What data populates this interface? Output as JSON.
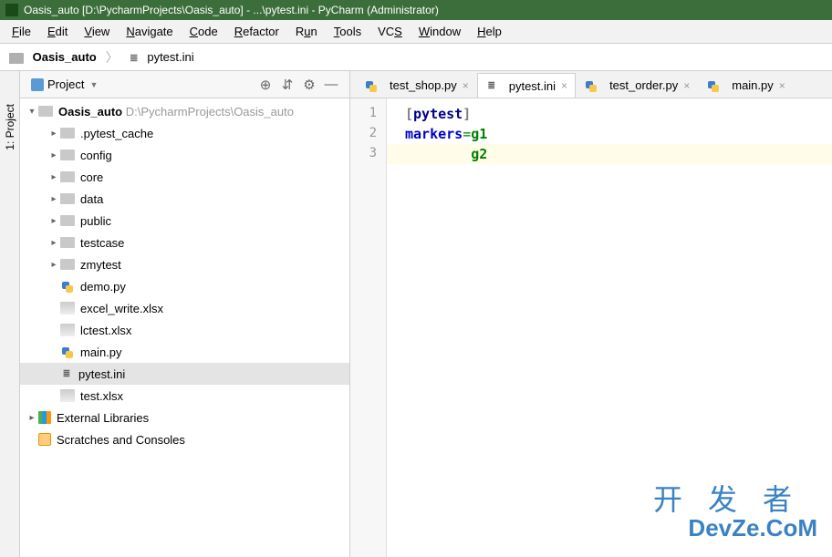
{
  "titlebar": {
    "text": "Oasis_auto [D:\\PycharmProjects\\Oasis_auto] - ...\\pytest.ini - PyCharm (Administrator)"
  },
  "menu": {
    "file": "File",
    "edit": "Edit",
    "view": "View",
    "navigate": "Navigate",
    "code": "Code",
    "refactor": "Refactor",
    "run": "Run",
    "tools": "Tools",
    "vcs": "VCS",
    "window": "Window",
    "help": "Help"
  },
  "breadcrumb": {
    "root": "Oasis_auto",
    "file": "pytest.ini"
  },
  "sidebar": {
    "project_tab": "1: Project"
  },
  "tree_header": {
    "label": "Project"
  },
  "tree": {
    "root": "Oasis_auto",
    "root_path": "D:\\PycharmProjects\\Oasis_auto",
    "dirs": [
      ".pytest_cache",
      "config",
      "core",
      "data",
      "public",
      "testcase",
      "zmytest"
    ],
    "files": [
      "demo.py",
      "excel_write.xlsx",
      "lctest.xlsx",
      "main.py",
      "pytest.ini",
      "test.xlsx"
    ],
    "ext_lib": "External Libraries",
    "scratches": "Scratches and Consoles"
  },
  "tabs": [
    {
      "name": "test_shop.py",
      "type": "py",
      "active": false
    },
    {
      "name": "pytest.ini",
      "type": "ini",
      "active": true
    },
    {
      "name": "test_order.py",
      "type": "py",
      "active": false
    },
    {
      "name": "main.py",
      "type": "py",
      "active": false
    }
  ],
  "editor": {
    "lines": [
      "1",
      "2",
      "3"
    ],
    "l1_section": "[pytest]",
    "l2_key": "markers",
    "l2_eq": "=",
    "l2_val": "g1",
    "l3_val": "g2"
  },
  "watermark": {
    "cn": "开发者",
    "en": "DevZe.CoM"
  }
}
